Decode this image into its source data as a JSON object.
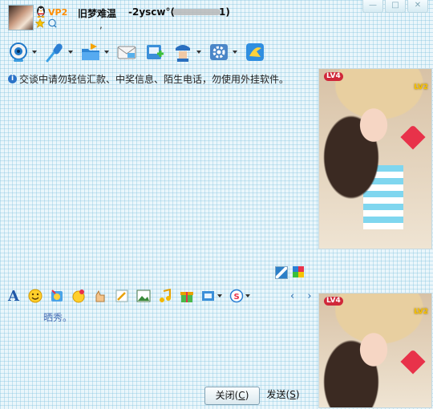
{
  "window": {
    "controls": [
      "—",
      "□",
      "✕"
    ]
  },
  "header": {
    "vip_badge": "VP2",
    "nickname": "旧梦难温",
    "qq_id": "-2yscw°(",
    "qq_id_tail": "1)",
    "signature": ","
  },
  "toolbar": {
    "items": [
      {
        "icon": "video-icon"
      },
      {
        "icon": "microphone-icon"
      },
      {
        "icon": "folder-transfer-icon"
      },
      {
        "icon": "email-icon"
      },
      {
        "icon": "sms-icon"
      },
      {
        "icon": "remote-assist-icon"
      },
      {
        "icon": "app-settings-icon"
      },
      {
        "icon": "qq-speed-icon"
      }
    ]
  },
  "notice": {
    "text": "交谈中请勿轻信汇款、中奖信息、陌生电话，勿使用外挂软件。"
  },
  "profile_photo": {
    "level_badge": "LV4",
    "level2_badge": "LV2"
  },
  "my_photo": {
    "level_badge": "LV4",
    "level2_badge": "LV2"
  },
  "input_toolbar": {
    "font_label": "A",
    "nav_arrows": "‹ ›"
  },
  "input": {
    "text": "晒秀。"
  },
  "buttons": {
    "close_label": "关闭(",
    "close_key": "C",
    "close_end": ")",
    "send_label": "发送(",
    "send_key": "S",
    "send_end": ")"
  },
  "colors": {
    "grid_bg": "#eaf6fb",
    "accent_blue": "#2158a8",
    "vip_orange": "#ff8c00",
    "badge_red": "#d0283a"
  }
}
